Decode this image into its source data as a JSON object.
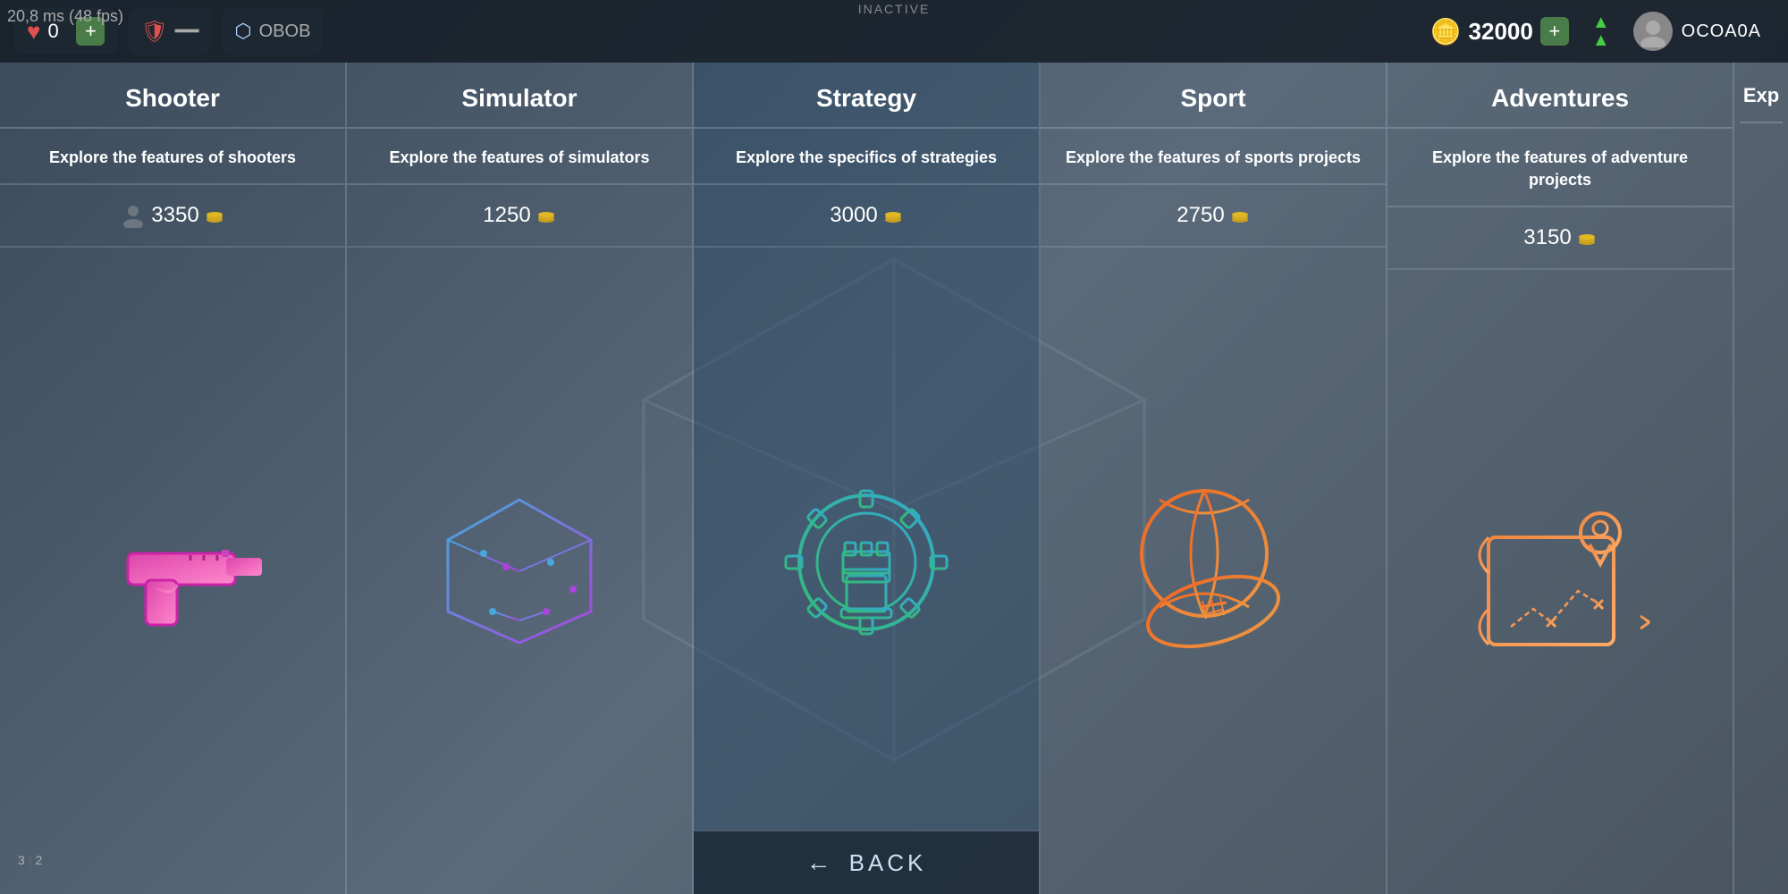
{
  "fps": "20,8 ms (48 fps)",
  "topbar": {
    "hearts": "0",
    "hearts_plus": "+",
    "coin_amount": "32000",
    "coin_plus": "+",
    "status": "INACTIVE",
    "username": "OCOA0A",
    "rank_icon": "▲▲"
  },
  "categories": [
    {
      "id": "shooter",
      "title": "Shooter",
      "description": "Explore the features of shooters",
      "cost": "3350",
      "icon_color": "#cc44aa",
      "icon_type": "gun"
    },
    {
      "id": "simulator",
      "title": "Simulator",
      "description": "Explore the features of simulators",
      "cost": "1250",
      "icon_color": "#44aacc",
      "icon_type": "cube"
    },
    {
      "id": "strategy",
      "title": "Strategy",
      "description": "Explore the specifics of strategies",
      "cost": "3000",
      "icon_color": "#44ccaa",
      "icon_type": "chess"
    },
    {
      "id": "sport",
      "title": "Sport",
      "description": "Explore the features of sports projects",
      "cost": "2750",
      "icon_color": "#ee6622",
      "icon_type": "sports"
    },
    {
      "id": "adventures",
      "title": "Adventures",
      "description": "Explore the features of adventure projects",
      "cost": "3150",
      "icon_color": "#ee8844",
      "icon_type": "map"
    }
  ],
  "back_button": {
    "label": "BACK",
    "arrow": "←"
  }
}
